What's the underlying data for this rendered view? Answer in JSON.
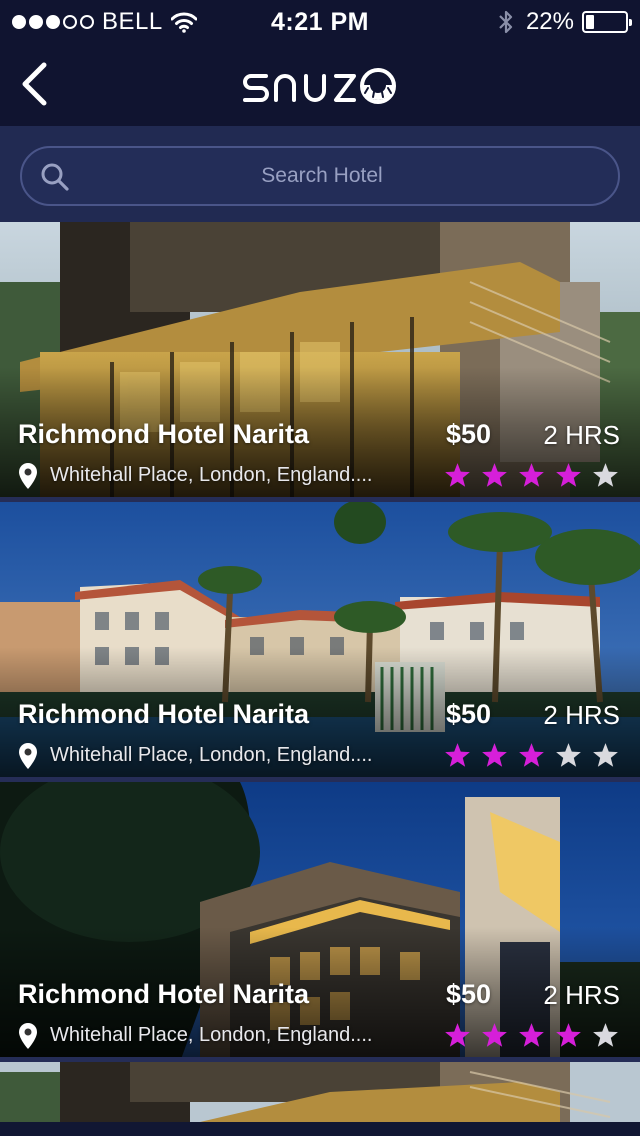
{
  "status_bar": {
    "signal_bars_filled": 3,
    "signal_bars_total": 5,
    "carrier": "BELL",
    "time": "4:21 PM",
    "battery": "22%",
    "battery_level": 0.22
  },
  "nav": {
    "logo_text": "snuze"
  },
  "search": {
    "placeholder": "Search Hotel",
    "value": ""
  },
  "colors": {
    "background": "#111733",
    "nav": "#101430",
    "search_bar": "#212a52",
    "star_filled": "#d61fd9",
    "star_empty": "#d9d9de"
  },
  "hotels": [
    {
      "name": "Richmond Hotel Narita",
      "price": "$50",
      "duration": "2 HRS",
      "address": "Whitehall Place, London, England....",
      "rating": 4,
      "rating_max": 5,
      "photo": "modern-hotel-night"
    },
    {
      "name": "Richmond Hotel Narita",
      "price": "$50",
      "duration": "2 HRS",
      "address": "Whitehall Place, London, England....",
      "rating": 3,
      "rating_max": 5,
      "photo": "resort-palms"
    },
    {
      "name": "Richmond Hotel Narita",
      "price": "$50",
      "duration": "2 HRS",
      "address": "Whitehall Place, London, England....",
      "rating": 4,
      "rating_max": 5,
      "photo": "hotel-tower-dusk"
    },
    {
      "name": "",
      "price": "",
      "duration": "",
      "address": "",
      "rating": 0,
      "rating_max": 5,
      "photo": "modern-hotel-night"
    }
  ]
}
